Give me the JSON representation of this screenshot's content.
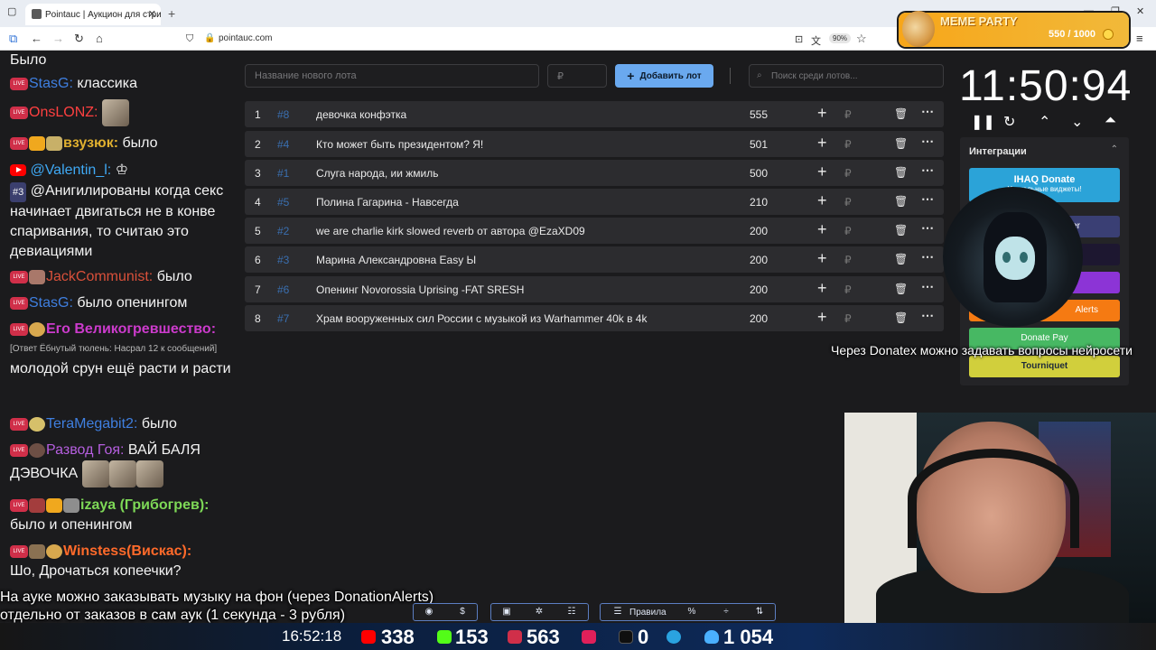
{
  "browser": {
    "tab_title": "Pointauc | Аукцион для стриме",
    "url": "pointauc.com",
    "zoom": "90%"
  },
  "meme_party": {
    "title": "MEME PARTY",
    "score": "550 / 1000"
  },
  "chat": {
    "messages": [
      {
        "text": "Было"
      },
      {
        "name": "StasG:",
        "text": "классика"
      },
      {
        "name": "OnsLONZ:",
        "text": ""
      },
      {
        "name": "взузюк:",
        "text": "было"
      },
      {
        "name": "@Valentin_l:",
        "text": ""
      },
      {
        "name": "#3",
        "text": "@Анигилированы когда секс начинает двигаться не в конве спаривания, то считаю это девиациями"
      },
      {
        "name": "JackCommunist:",
        "text": "было"
      },
      {
        "name": "StasG:",
        "text": "было опенингом"
      },
      {
        "name": "Его Великогревшество:",
        "reply": "[Ответ Ёбнутый тюлень: Насрал 12 к сообщений]",
        "text": "молодой срун ещё расти и расти"
      },
      {
        "name": "TeraMegabit2:",
        "text": "было"
      },
      {
        "name": "Развод Гоя:",
        "text": "ВАЙ БАЛЯ ДЭВОЧКА"
      },
      {
        "name": "izaya (Грибогрев):",
        "text": "было и опенингом"
      },
      {
        "name": "Winstess(Вискас):",
        "text": "Шо, Дрочаться копеечки?"
      }
    ]
  },
  "auction": {
    "new_lot_placeholder": "Название нового лота",
    "price_placeholder": "₽",
    "add_button": "Добавить лот",
    "search_placeholder": "Поиск среди лотов...",
    "lots": [
      {
        "idx": "1",
        "id": "#8",
        "name": "девочка конфэтка",
        "amount": "555"
      },
      {
        "idx": "2",
        "id": "#4",
        "name": "Кто может быть президентом? Я!",
        "amount": "501"
      },
      {
        "idx": "3",
        "id": "#1",
        "name": "Слуга народа, ии жмиль",
        "amount": "500"
      },
      {
        "idx": "4",
        "id": "#5",
        "name": "Полина Гагарина - Навсегда",
        "amount": "210"
      },
      {
        "idx": "5",
        "id": "#2",
        "name": "we are charlie kirk slowed reverb от автора @EzaXD09",
        "amount": "200"
      },
      {
        "idx": "6",
        "id": "#3",
        "name": "Марина Александровна Easy Ы",
        "amount": "200"
      },
      {
        "idx": "7",
        "id": "#6",
        "name": "Опенинг Novorossia Uprising -FAT SRESH",
        "amount": "200"
      },
      {
        "idx": "8",
        "id": "#7",
        "name": "Храм вооруженных сил России с музыкой из Warhammer 40k в 4k",
        "amount": "200"
      }
    ],
    "rub": "₽"
  },
  "timer": {
    "value": "11:50:94"
  },
  "integrations": {
    "title": "Интеграции",
    "ihaq_title": "IHAQ Donate",
    "ihaq_sub": "Уникальные виджеты!",
    "alerts": "Alerts",
    "donatepay": "Donate Pay",
    "tourniquet": "Tourniquet",
    "partial_er": "er"
  },
  "overlay": {
    "donatex": "Через Donatex можно задавать вопросы нейросети",
    "subtitle_1": "На ауке можно заказывать музыку на фон (через DonationAlerts)",
    "subtitle_2": "отдельно от заказов в сам аук (1 секунда - 3 рубля)",
    "rules": "Правила"
  },
  "stats": {
    "clock": "16:52:18",
    "youtube": "338",
    "kick": "153",
    "live": "563",
    "rutube": "0",
    "viewers": "1 054"
  },
  "colors": {
    "accent": "#6aa9ef",
    "lot_row": "#2c2c2f",
    "ihaq": "#2ba3d8",
    "donatepay": "#47b863",
    "alerts": "#f57a12",
    "tourniquet": "#d1cf3c"
  }
}
